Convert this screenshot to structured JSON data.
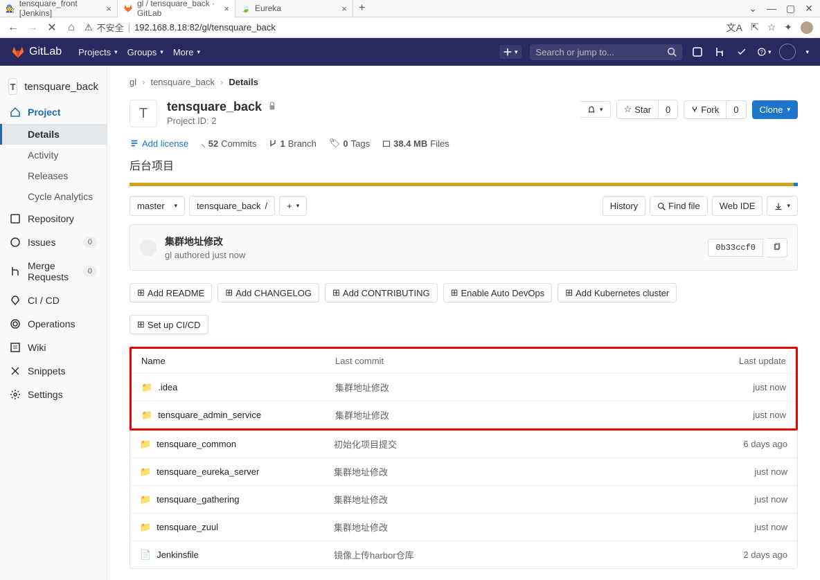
{
  "browser": {
    "tabs": [
      {
        "title": "tensquare_front [Jenkins]",
        "fav": "jenkins"
      },
      {
        "title": "gl / tensquare_back · GitLab",
        "fav": "gitlab",
        "active": true
      },
      {
        "title": "Eureka",
        "fav": "spring"
      }
    ],
    "addr_warn": "不安全",
    "url": "192.168.8.18:82/gl/tensquare_back"
  },
  "header": {
    "brand": "GitLab",
    "menu": [
      "Projects",
      "Groups",
      "More"
    ],
    "search_placeholder": "Search or jump to..."
  },
  "sidebar": {
    "project_letter": "T",
    "project_name": "tensquare_back",
    "sections": {
      "project": "Project",
      "subs": [
        {
          "label": "Details",
          "active": true
        },
        {
          "label": "Activity"
        },
        {
          "label": "Releases"
        },
        {
          "label": "Cycle Analytics"
        }
      ],
      "items": [
        {
          "label": "Repository",
          "icon": "book"
        },
        {
          "label": "Issues",
          "icon": "issue",
          "count": 0
        },
        {
          "label": "Merge Requests",
          "icon": "merge",
          "count": 0
        },
        {
          "label": "CI / CD",
          "icon": "ci"
        },
        {
          "label": "Operations",
          "icon": "ops"
        },
        {
          "label": "Wiki",
          "icon": "wiki"
        },
        {
          "label": "Snippets",
          "icon": "snip"
        },
        {
          "label": "Settings",
          "icon": "gear"
        }
      ]
    }
  },
  "breadcrumb": {
    "root": "gl",
    "project": "tensquare_back",
    "current": "Details"
  },
  "project": {
    "letter": "T",
    "title": "tensquare_back",
    "project_id": "Project ID: 2",
    "add_license": "Add license",
    "commits": {
      "n": "52",
      "label": "Commits"
    },
    "branches": {
      "n": "1",
      "label": "Branch"
    },
    "tags": {
      "n": "0",
      "label": "Tags"
    },
    "files": {
      "n": "38.4 MB",
      "label": "Files"
    },
    "desc": "后台项目",
    "star": "Star",
    "star_n": "0",
    "fork": "Fork",
    "fork_n": "0",
    "clone": "Clone"
  },
  "repo": {
    "branch": "master",
    "path": "tensquare_back",
    "history": "History",
    "find": "Find file",
    "ide": "Web IDE"
  },
  "commit": {
    "msg": "集群地址修改",
    "author": "gl",
    "by_suffix": "authored just now",
    "sha": "0b33ccf0"
  },
  "setup": [
    "Add README",
    "Add CHANGELOG",
    "Add CONTRIBUTING",
    "Enable Auto DevOps",
    "Add Kubernetes cluster",
    "Set up CI/CD"
  ],
  "tree": {
    "head": {
      "name": "Name",
      "commit": "Last commit",
      "update": "Last update"
    },
    "hl_rows": [
      {
        "icon": "folder",
        "name": ".idea",
        "commit": "集群地址修改",
        "update": "just now"
      },
      {
        "icon": "folder",
        "name": "tensquare_admin_service",
        "commit": "集群地址修改",
        "update": "just now"
      }
    ],
    "rows": [
      {
        "icon": "folder",
        "name": "tensquare_common",
        "commit": "初始化项目提交",
        "update": "6 days ago"
      },
      {
        "icon": "folder",
        "name": "tensquare_eureka_server",
        "commit": "集群地址修改",
        "update": "just now"
      },
      {
        "icon": "folder",
        "name": "tensquare_gathering",
        "commit": "集群地址修改",
        "update": "just now"
      },
      {
        "icon": "folder",
        "name": "tensquare_zuul",
        "commit": "集群地址修改",
        "update": "just now"
      },
      {
        "icon": "file",
        "name": "Jenkinsfile",
        "commit": "镜像上传harbor仓库",
        "update": "2 days ago"
      }
    ]
  }
}
